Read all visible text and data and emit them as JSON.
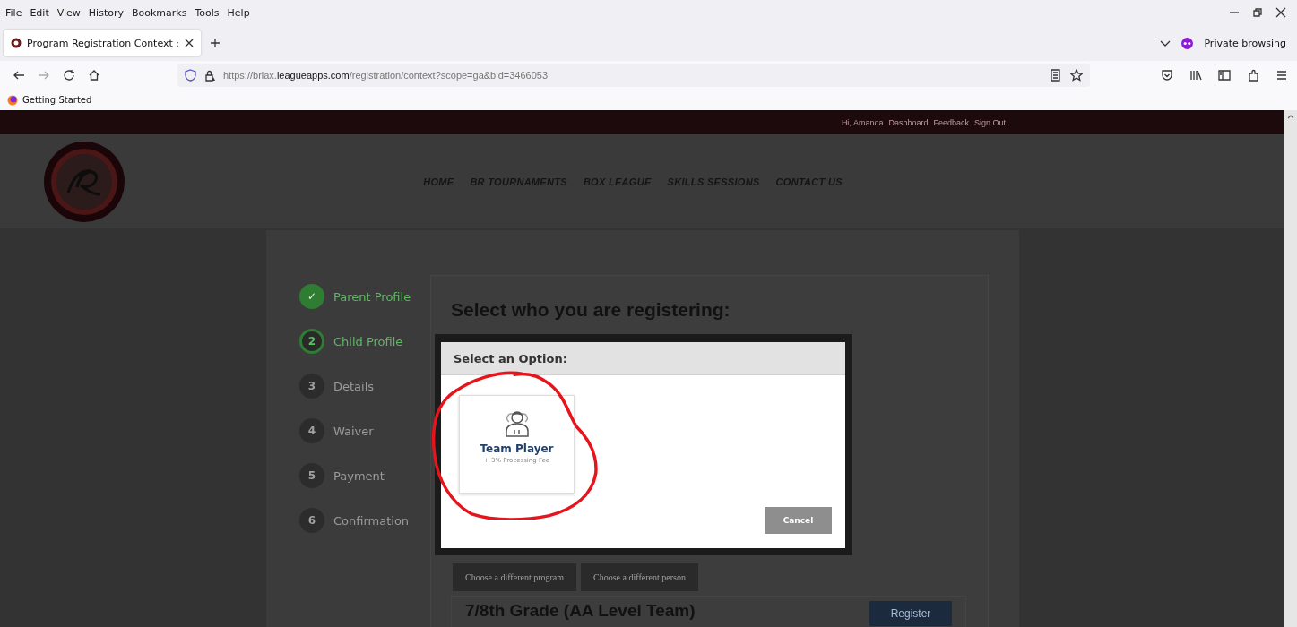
{
  "menu_bar": [
    "File",
    "Edit",
    "View",
    "History",
    "Bookmarks",
    "Tools",
    "Help"
  ],
  "tab": {
    "title": "Program Registration Context :",
    "selected": true
  },
  "private_label": "Private browsing",
  "address_bar": {
    "url_prefix": "https://brlax.",
    "url_domain": "leagueapps.com",
    "url_path": "/registration/context?scope=ga&bid=3466053"
  },
  "bookmarks": [
    "Getting Started"
  ],
  "site": {
    "user_links": [
      "Hi, Amanda",
      "Dashboard",
      "Feedback",
      "Sign Out"
    ],
    "nav": [
      "HOME",
      "BR TOURNAMENTS",
      "BOX LEAGUE",
      "SKILLS SESSIONS",
      "CONTACT US"
    ]
  },
  "steps": [
    {
      "marker": "✓",
      "label": "Parent Profile",
      "completed": true,
      "selected": false
    },
    {
      "marker": "2",
      "label": "Child Profile",
      "completed": false,
      "selected": true
    },
    {
      "marker": "3",
      "label": "Details",
      "completed": false,
      "selected": false
    },
    {
      "marker": "4",
      "label": "Waiver",
      "completed": false,
      "selected": false
    },
    {
      "marker": "5",
      "label": "Payment",
      "completed": false,
      "selected": false
    },
    {
      "marker": "6",
      "label": "Confirmation",
      "completed": false,
      "selected": false
    }
  ],
  "heading": "Select who you are registering:",
  "actions": [
    "Choose a different program",
    "Choose a different person"
  ],
  "program": {
    "title": "7/8th Grade (AA Level Team)",
    "button": "Register"
  },
  "modal": {
    "title": "Select an Option:",
    "options": [
      {
        "title": "Team Player",
        "subtitle": "+ 3% Processing Fee"
      }
    ],
    "cancel": "Cancel"
  }
}
